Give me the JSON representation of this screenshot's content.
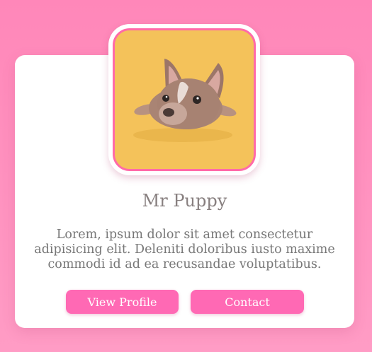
{
  "profile": {
    "name": "Mr Puppy",
    "bio": "Lorem, ipsum dolor sit amet consectetur adipisicing elit. Deleniti doloribus iusto maxime commodi id ad ea recusandae voluptatibus.",
    "image_icon": "french-bulldog-puppy-photo"
  },
  "actions": {
    "view_profile_label": "View Profile",
    "contact_label": "Contact"
  },
  "colors": {
    "background": "#ff8fbe",
    "accent": "#ff69b4",
    "photo_backdrop": "#f4c25a"
  }
}
